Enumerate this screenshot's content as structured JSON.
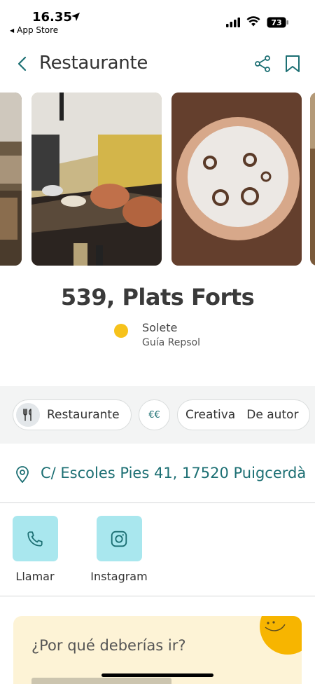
{
  "status_bar": {
    "time": "16.35",
    "back_app": "App Store",
    "battery": "73"
  },
  "nav": {
    "title": "Restaurante",
    "back_icon": "chevron-left-icon",
    "share_icon": "share-icon",
    "bookmark_icon": "bookmark-icon"
  },
  "restaurant": {
    "name": "539, Plats Forts",
    "award_title": "Solete",
    "award_source": "Guía Repsol"
  },
  "categories": {
    "type_label": "Restaurante",
    "price": "€€",
    "cuisine_1": "Creativa",
    "cuisine_2": "De autor"
  },
  "address": "C/ Escoles Pies 41, 17520 Puigcerdà",
  "actions": {
    "call_label": "Llamar",
    "instagram_label": "Instagram"
  },
  "why_card": {
    "title": "¿Por qué deberías ir?"
  },
  "colors": {
    "accent_teal": "#1c6f73",
    "action_bg": "#a9e7ee",
    "sun_yellow": "#f6c21b",
    "card_bg": "#fdf3d6"
  }
}
